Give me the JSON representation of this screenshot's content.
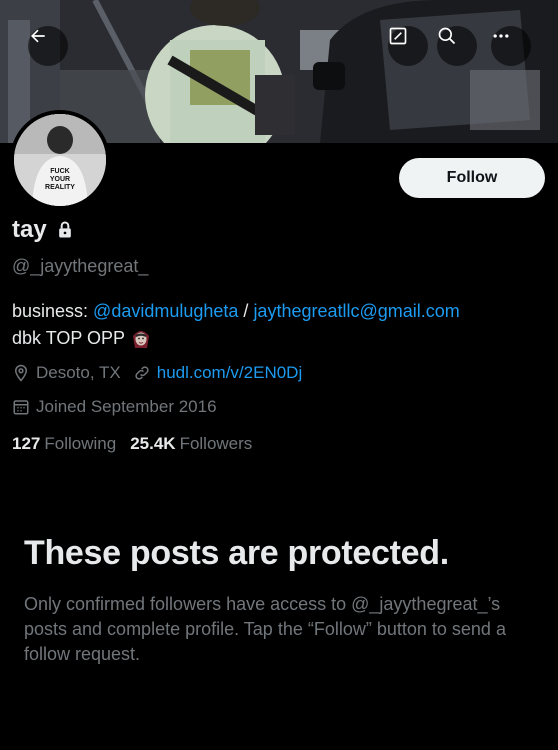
{
  "header": {
    "back_icon": "arrow-left-icon",
    "edit_icon": "edit-square-icon",
    "search_icon": "search-icon",
    "more_icon": "more-horizontal-icon"
  },
  "profile": {
    "name": "tay",
    "handle": "@_jayythegreat_",
    "follow_label": "Follow",
    "bio_prefix": "business: ",
    "bio_mention": "@davidmulugheta",
    "bio_sep": " / ",
    "bio_email": "jaythegreatllc@gmail.com",
    "bio_line2": "dbk TOP OPP",
    "location": "Desoto, TX",
    "website": "hudl.com/v/2EN0Dj",
    "joined": "Joined September 2016",
    "following_count": "127",
    "following_label": "Following",
    "followers_count": "25.4K",
    "followers_label": "Followers",
    "avatar_shirt_text": "FUCK YOUR REALITY"
  },
  "protected": {
    "title": "These posts are protected.",
    "message": "Only confirmed followers have access to @_jayythegreat_’s posts and complete profile. Tap the “Follow” button to send a follow request."
  },
  "colors": {
    "background": "#000000",
    "text_primary": "#e7e9ea",
    "text_secondary": "#71767b",
    "link": "#1d9bf0",
    "follow_bg": "#eff3f4"
  }
}
